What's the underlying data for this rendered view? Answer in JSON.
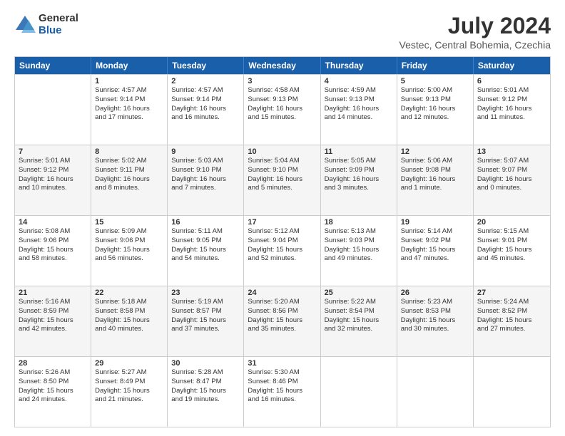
{
  "logo": {
    "general": "General",
    "blue": "Blue"
  },
  "title": "July 2024",
  "subtitle": "Vestec, Central Bohemia, Czechia",
  "days": [
    "Sunday",
    "Monday",
    "Tuesday",
    "Wednesday",
    "Thursday",
    "Friday",
    "Saturday"
  ],
  "rows": [
    [
      {
        "day": "",
        "lines": [],
        "shaded": false
      },
      {
        "day": "1",
        "lines": [
          "Sunrise: 4:57 AM",
          "Sunset: 9:14 PM",
          "Daylight: 16 hours",
          "and 17 minutes."
        ],
        "shaded": false
      },
      {
        "day": "2",
        "lines": [
          "Sunrise: 4:57 AM",
          "Sunset: 9:14 PM",
          "Daylight: 16 hours",
          "and 16 minutes."
        ],
        "shaded": false
      },
      {
        "day": "3",
        "lines": [
          "Sunrise: 4:58 AM",
          "Sunset: 9:13 PM",
          "Daylight: 16 hours",
          "and 15 minutes."
        ],
        "shaded": false
      },
      {
        "day": "4",
        "lines": [
          "Sunrise: 4:59 AM",
          "Sunset: 9:13 PM",
          "Daylight: 16 hours",
          "and 14 minutes."
        ],
        "shaded": false
      },
      {
        "day": "5",
        "lines": [
          "Sunrise: 5:00 AM",
          "Sunset: 9:13 PM",
          "Daylight: 16 hours",
          "and 12 minutes."
        ],
        "shaded": false
      },
      {
        "day": "6",
        "lines": [
          "Sunrise: 5:01 AM",
          "Sunset: 9:12 PM",
          "Daylight: 16 hours",
          "and 11 minutes."
        ],
        "shaded": false
      }
    ],
    [
      {
        "day": "7",
        "lines": [
          "Sunrise: 5:01 AM",
          "Sunset: 9:12 PM",
          "Daylight: 16 hours",
          "and 10 minutes."
        ],
        "shaded": true
      },
      {
        "day": "8",
        "lines": [
          "Sunrise: 5:02 AM",
          "Sunset: 9:11 PM",
          "Daylight: 16 hours",
          "and 8 minutes."
        ],
        "shaded": true
      },
      {
        "day": "9",
        "lines": [
          "Sunrise: 5:03 AM",
          "Sunset: 9:10 PM",
          "Daylight: 16 hours",
          "and 7 minutes."
        ],
        "shaded": true
      },
      {
        "day": "10",
        "lines": [
          "Sunrise: 5:04 AM",
          "Sunset: 9:10 PM",
          "Daylight: 16 hours",
          "and 5 minutes."
        ],
        "shaded": true
      },
      {
        "day": "11",
        "lines": [
          "Sunrise: 5:05 AM",
          "Sunset: 9:09 PM",
          "Daylight: 16 hours",
          "and 3 minutes."
        ],
        "shaded": true
      },
      {
        "day": "12",
        "lines": [
          "Sunrise: 5:06 AM",
          "Sunset: 9:08 PM",
          "Daylight: 16 hours",
          "and 1 minute."
        ],
        "shaded": true
      },
      {
        "day": "13",
        "lines": [
          "Sunrise: 5:07 AM",
          "Sunset: 9:07 PM",
          "Daylight: 16 hours",
          "and 0 minutes."
        ],
        "shaded": true
      }
    ],
    [
      {
        "day": "14",
        "lines": [
          "Sunrise: 5:08 AM",
          "Sunset: 9:06 PM",
          "Daylight: 15 hours",
          "and 58 minutes."
        ],
        "shaded": false
      },
      {
        "day": "15",
        "lines": [
          "Sunrise: 5:09 AM",
          "Sunset: 9:06 PM",
          "Daylight: 15 hours",
          "and 56 minutes."
        ],
        "shaded": false
      },
      {
        "day": "16",
        "lines": [
          "Sunrise: 5:11 AM",
          "Sunset: 9:05 PM",
          "Daylight: 15 hours",
          "and 54 minutes."
        ],
        "shaded": false
      },
      {
        "day": "17",
        "lines": [
          "Sunrise: 5:12 AM",
          "Sunset: 9:04 PM",
          "Daylight: 15 hours",
          "and 52 minutes."
        ],
        "shaded": false
      },
      {
        "day": "18",
        "lines": [
          "Sunrise: 5:13 AM",
          "Sunset: 9:03 PM",
          "Daylight: 15 hours",
          "and 49 minutes."
        ],
        "shaded": false
      },
      {
        "day": "19",
        "lines": [
          "Sunrise: 5:14 AM",
          "Sunset: 9:02 PM",
          "Daylight: 15 hours",
          "and 47 minutes."
        ],
        "shaded": false
      },
      {
        "day": "20",
        "lines": [
          "Sunrise: 5:15 AM",
          "Sunset: 9:01 PM",
          "Daylight: 15 hours",
          "and 45 minutes."
        ],
        "shaded": false
      }
    ],
    [
      {
        "day": "21",
        "lines": [
          "Sunrise: 5:16 AM",
          "Sunset: 8:59 PM",
          "Daylight: 15 hours",
          "and 42 minutes."
        ],
        "shaded": true
      },
      {
        "day": "22",
        "lines": [
          "Sunrise: 5:18 AM",
          "Sunset: 8:58 PM",
          "Daylight: 15 hours",
          "and 40 minutes."
        ],
        "shaded": true
      },
      {
        "day": "23",
        "lines": [
          "Sunrise: 5:19 AM",
          "Sunset: 8:57 PM",
          "Daylight: 15 hours",
          "and 37 minutes."
        ],
        "shaded": true
      },
      {
        "day": "24",
        "lines": [
          "Sunrise: 5:20 AM",
          "Sunset: 8:56 PM",
          "Daylight: 15 hours",
          "and 35 minutes."
        ],
        "shaded": true
      },
      {
        "day": "25",
        "lines": [
          "Sunrise: 5:22 AM",
          "Sunset: 8:54 PM",
          "Daylight: 15 hours",
          "and 32 minutes."
        ],
        "shaded": true
      },
      {
        "day": "26",
        "lines": [
          "Sunrise: 5:23 AM",
          "Sunset: 8:53 PM",
          "Daylight: 15 hours",
          "and 30 minutes."
        ],
        "shaded": true
      },
      {
        "day": "27",
        "lines": [
          "Sunrise: 5:24 AM",
          "Sunset: 8:52 PM",
          "Daylight: 15 hours",
          "and 27 minutes."
        ],
        "shaded": true
      }
    ],
    [
      {
        "day": "28",
        "lines": [
          "Sunrise: 5:26 AM",
          "Sunset: 8:50 PM",
          "Daylight: 15 hours",
          "and 24 minutes."
        ],
        "shaded": false
      },
      {
        "day": "29",
        "lines": [
          "Sunrise: 5:27 AM",
          "Sunset: 8:49 PM",
          "Daylight: 15 hours",
          "and 21 minutes."
        ],
        "shaded": false
      },
      {
        "day": "30",
        "lines": [
          "Sunrise: 5:28 AM",
          "Sunset: 8:47 PM",
          "Daylight: 15 hours",
          "and 19 minutes."
        ],
        "shaded": false
      },
      {
        "day": "31",
        "lines": [
          "Sunrise: 5:30 AM",
          "Sunset: 8:46 PM",
          "Daylight: 15 hours",
          "and 16 minutes."
        ],
        "shaded": false
      },
      {
        "day": "",
        "lines": [],
        "shaded": false
      },
      {
        "day": "",
        "lines": [],
        "shaded": false
      },
      {
        "day": "",
        "lines": [],
        "shaded": false
      }
    ]
  ]
}
